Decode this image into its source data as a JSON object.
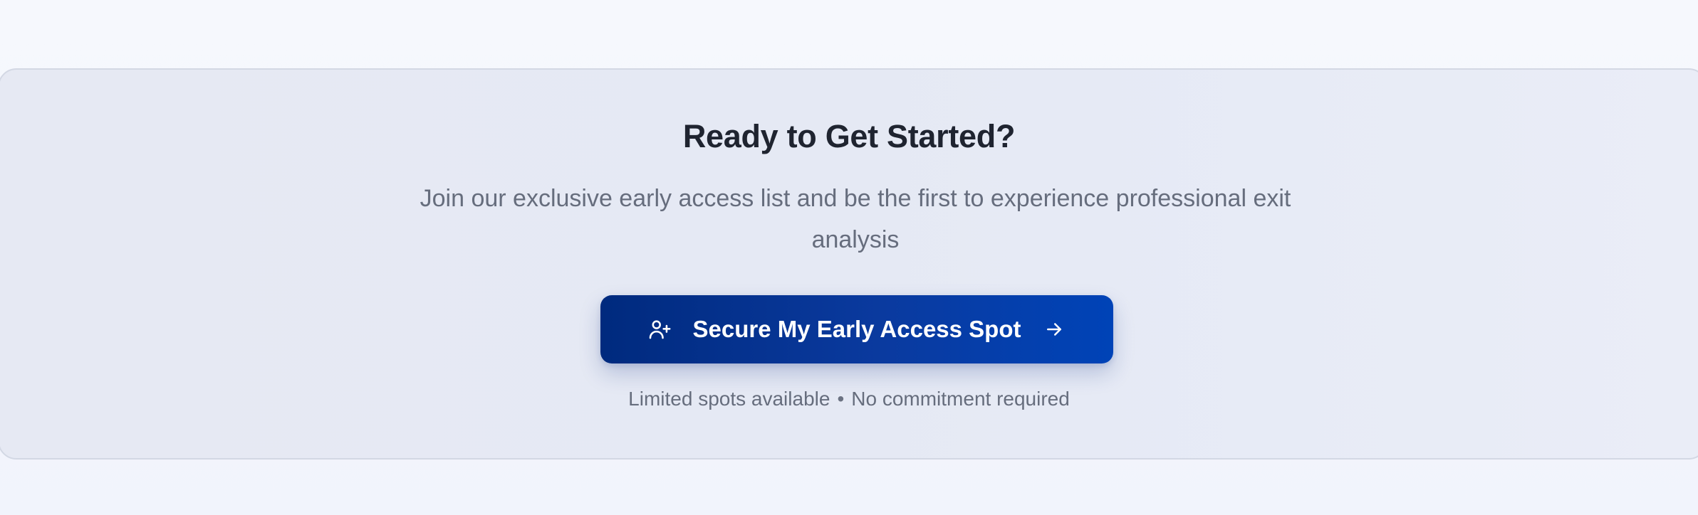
{
  "cta": {
    "title": "Ready to Get Started?",
    "subtitle": "Join our exclusive early access list and be the first to experience professional exit analysis",
    "button_label": "Secure My Early Access Spot",
    "button_leading_icon": "user-plus-icon",
    "button_trailing_icon": "arrow-right-icon",
    "note_part_1": "Limited spots available",
    "note_separator": "•",
    "note_part_2": "No commitment required"
  },
  "colors": {
    "page_background": "#f4f6fd",
    "card_background": "#e6e9f3",
    "title": "#1f2430",
    "body_text": "#666d7d",
    "button_start": "#002a7e",
    "button_end": "#0043b7",
    "button_text": "#ffffff"
  }
}
